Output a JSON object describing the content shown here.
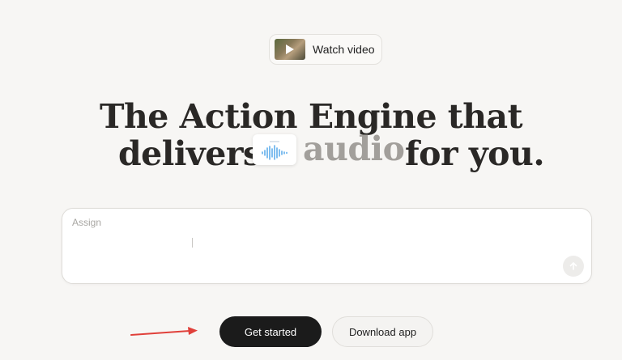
{
  "watch_video": {
    "label": "Watch video",
    "thumbnail_icon": "play-icon"
  },
  "hero": {
    "line1": "The Action Engine that",
    "line2_start": "delivers",
    "rotating_word": "audio",
    "line2_end": "for you.",
    "audio_card_icon": "sound-wave-icon"
  },
  "assign": {
    "placeholder": "Assign",
    "value": "",
    "send_icon": "arrow-up-icon"
  },
  "cta": {
    "primary": "Get started",
    "secondary": "Download app"
  },
  "annotation": {
    "icon": "red-arrow-icon",
    "color": "#e0403a"
  },
  "colors": {
    "background": "#f7f6f4",
    "primary_button": "#1b1b1b",
    "headline": "#2a2826",
    "rotating_word": "#a29f9b",
    "wave": "#4aa3e8"
  }
}
